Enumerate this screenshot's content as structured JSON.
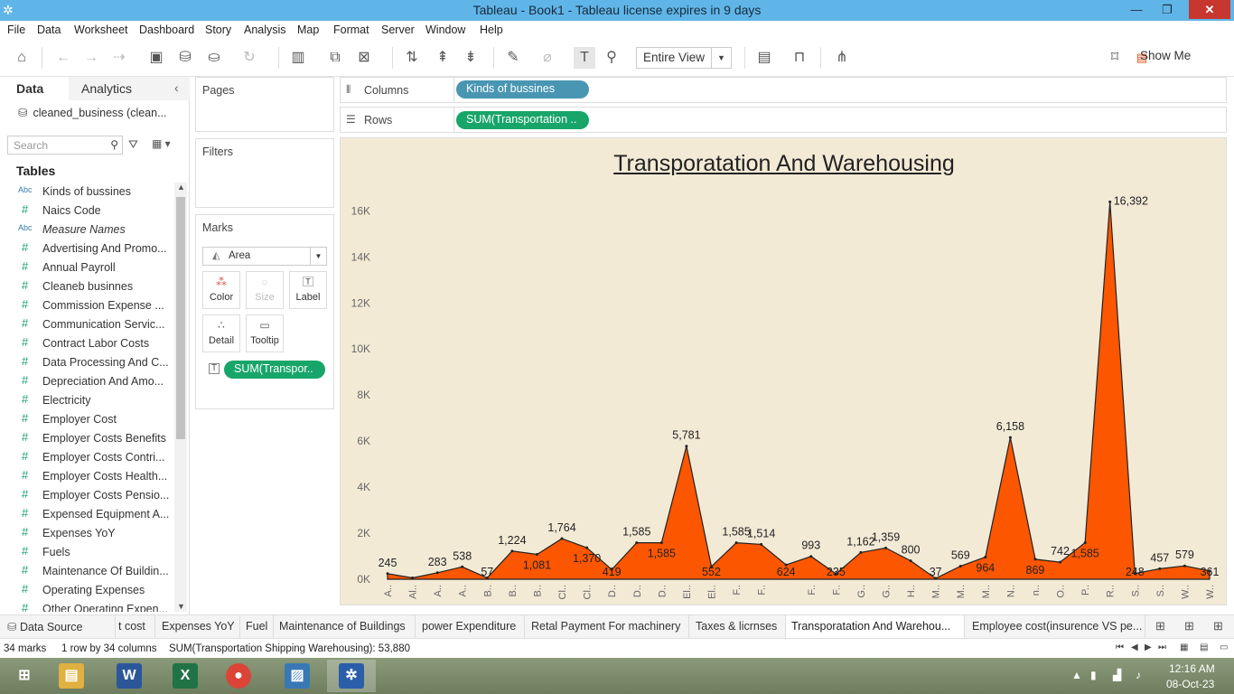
{
  "window": {
    "title": "Tableau - Book1 - Tableau license expires in 9 days",
    "min_label": "—",
    "max_label": "❐",
    "close_label": "✕"
  },
  "menu": [
    "File",
    "Data",
    "Worksheet",
    "Dashboard",
    "Story",
    "Analysis",
    "Map",
    "Format",
    "Server",
    "Window",
    "Help"
  ],
  "toolbar": {
    "fit_value": "Entire View",
    "show_me_label": "Show Me"
  },
  "data_pane": {
    "tab_data": "Data",
    "tab_analytics": "Analytics",
    "datasource": "cleaned_business (clean...",
    "search_placeholder": "Search",
    "tables_header": "Tables",
    "fields": [
      {
        "type": "Abc",
        "name": "Kinds of bussines",
        "italic": false
      },
      {
        "type": "#",
        "name": "Naics Code",
        "italic": false
      },
      {
        "type": "Abc",
        "name": "Measure Names",
        "italic": true
      },
      {
        "type": "#",
        "name": "Advertising And Promo...",
        "italic": false
      },
      {
        "type": "#",
        "name": "Annual Payroll",
        "italic": false
      },
      {
        "type": "#",
        "name": "Cleaneb businnes",
        "italic": false
      },
      {
        "type": "#",
        "name": "Commission Expense ...",
        "italic": false
      },
      {
        "type": "#",
        "name": "Communication Servic...",
        "italic": false
      },
      {
        "type": "#",
        "name": "Contract Labor Costs",
        "italic": false
      },
      {
        "type": "#",
        "name": "Data Processing And C...",
        "italic": false
      },
      {
        "type": "#",
        "name": "Depreciation And Amo...",
        "italic": false
      },
      {
        "type": "#",
        "name": "Electricity",
        "italic": false
      },
      {
        "type": "#",
        "name": "Employer Cost",
        "italic": false
      },
      {
        "type": "#",
        "name": "Employer Costs Benefits",
        "italic": false
      },
      {
        "type": "#",
        "name": "Employer Costs Contri...",
        "italic": false
      },
      {
        "type": "#",
        "name": "Employer Costs Health...",
        "italic": false
      },
      {
        "type": "#",
        "name": "Employer Costs Pensio...",
        "italic": false
      },
      {
        "type": "#",
        "name": "Expensed Equipment A...",
        "italic": false
      },
      {
        "type": "#",
        "name": "Expenses YoY",
        "italic": false
      },
      {
        "type": "#",
        "name": "Fuels",
        "italic": false
      },
      {
        "type": "#",
        "name": "Maintenance Of Buildin...",
        "italic": false
      },
      {
        "type": "#",
        "name": "Operating Expenses",
        "italic": false
      },
      {
        "type": "#",
        "name": "Other Operating Expen...",
        "italic": false
      }
    ]
  },
  "cards": {
    "pages": "Pages",
    "filters": "Filters",
    "marks": "Marks",
    "mark_type": "Area",
    "buttons": [
      "Color",
      "Size",
      "Label",
      "Detail",
      "Tooltip"
    ],
    "marks_pill": "SUM(Transpor..",
    "marks_pill_icon": "T"
  },
  "shelves": {
    "columns_label": "Columns",
    "columns_pill": "Kinds of bussines",
    "rows_label": "Rows",
    "rows_pill": "SUM(Transportation .."
  },
  "chart_data": {
    "type": "area",
    "title": "Transporatation And Warehousing",
    "ylim": [
      0,
      16800
    ],
    "y_ticks": [
      "0K",
      "2K",
      "4K",
      "6K",
      "8K",
      "10K",
      "12K",
      "14K",
      "16K"
    ],
    "y_tick_values": [
      0,
      2000,
      4000,
      6000,
      8000,
      10000,
      12000,
      14000,
      16000
    ],
    "categories": [
      "A..",
      "Al..",
      "A..",
      "A..",
      "B..",
      "B..",
      "B..",
      "Cl..",
      "Cl..",
      "D..",
      "D..",
      "D..",
      "El..",
      "El..",
      "F..",
      "F..",
      "F..",
      "F..",
      "G..",
      "G..",
      "H..",
      "M..",
      "M..",
      "M..",
      "N..",
      "n..",
      "O..",
      "P..",
      "R..",
      "S..",
      "S..",
      "W..",
      "W.."
    ],
    "values": [
      245,
      60,
      283,
      538,
      57,
      1224,
      1081,
      1764,
      1370,
      419,
      1585,
      1585,
      5781,
      552,
      1585,
      1514,
      624,
      993,
      235,
      1162,
      1359,
      800,
      37,
      569,
      964,
      6158,
      869,
      742,
      1585,
      16392,
      248,
      457,
      579,
      361
    ],
    "labels": [
      "245",
      "",
      "283",
      "538",
      "57",
      "1,224",
      "1,081",
      "1,764",
      "1,370",
      "419",
      "1,585",
      "1,585",
      "5,781",
      "552",
      "1,585",
      "1,514",
      "624",
      "993",
      "235",
      "1,162",
      "1,359",
      "800",
      "37",
      "569",
      "964",
      "6,158",
      "869",
      "742",
      "1,585",
      "16,392",
      "248",
      "457",
      "579",
      "361"
    ],
    "label_position": [
      "above",
      "",
      "above",
      "above",
      "below",
      "above",
      "below",
      "above",
      "below",
      "below",
      "above",
      "below",
      "above",
      "below",
      "above",
      "above",
      "below",
      "above",
      "below",
      "above",
      "above",
      "above",
      "below",
      "above",
      "below",
      "above",
      "below",
      "above",
      "below",
      "above",
      "below",
      "above",
      "above",
      "below"
    ],
    "fill_color": "#fd5600",
    "line_color": "#222222",
    "background": "#f3ead6"
  },
  "sheet_tabs": {
    "data_source": "Data Source",
    "tabs": [
      "t cost",
      "Expenses YoY",
      "Fuel",
      "Maintenance of Buildings",
      "power Expenditure",
      "Retal Payment For machinery",
      "Taxes & licrnses",
      "Transporatation And Warehou...",
      "Employee cost(insurence VS pe..."
    ],
    "active_index": 7
  },
  "status": {
    "marks": "34 marks",
    "dims": "1 row by 34 columns",
    "sum": "SUM(Transportation Shipping Warehousing): 53,880"
  },
  "taskbar": {
    "time": "12:16 AM",
    "date": "08-Oct-23"
  }
}
